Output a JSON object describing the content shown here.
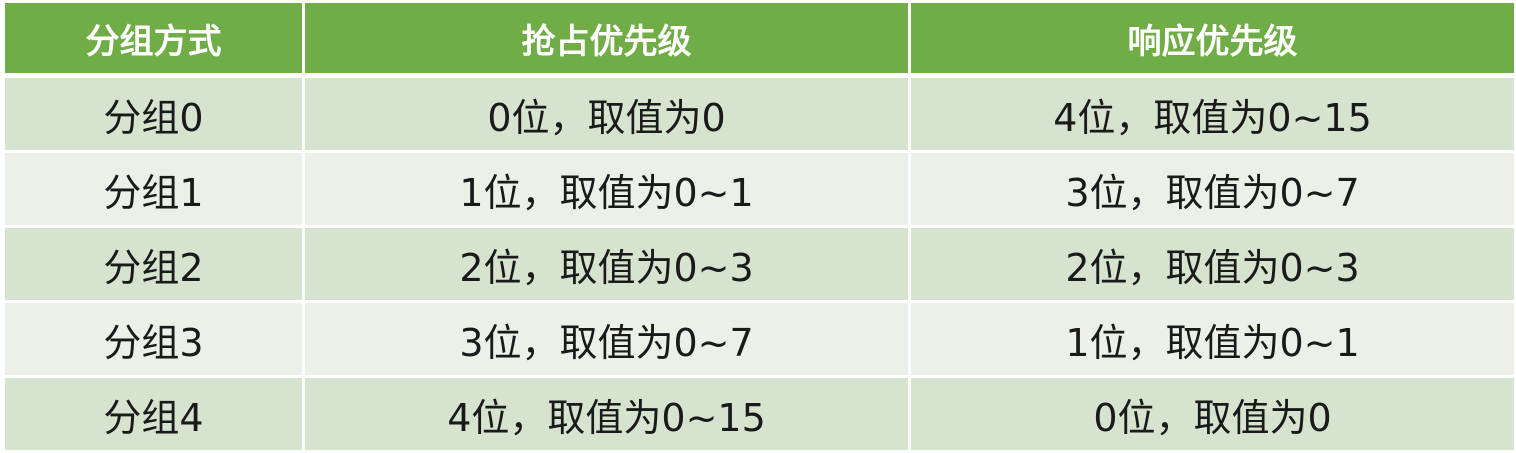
{
  "table": {
    "headers": [
      "分组方式",
      "抢占优先级",
      "响应优先级"
    ],
    "rows": [
      {
        "group": "分组0",
        "preempt": "0位，取值为0",
        "response": "4位，取值为0~15"
      },
      {
        "group": "分组1",
        "preempt": "1位，取值为0~1",
        "response": "3位，取值为0~7"
      },
      {
        "group": "分组2",
        "preempt": "2位，取值为0~3",
        "response": "2位，取值为0~3"
      },
      {
        "group": "分组3",
        "preempt": "3位，取值为0~7",
        "response": "1位，取值为0~1"
      },
      {
        "group": "分组4",
        "preempt": "4位，取值为0~15",
        "response": "0位，取值为0"
      }
    ]
  },
  "colors": {
    "header_bg": "#70ad47",
    "row_even_bg": "#d5e3cf",
    "row_odd_bg": "#ebf1e9",
    "header_text": "#ffffff",
    "cell_text": "#1a1a1a"
  }
}
